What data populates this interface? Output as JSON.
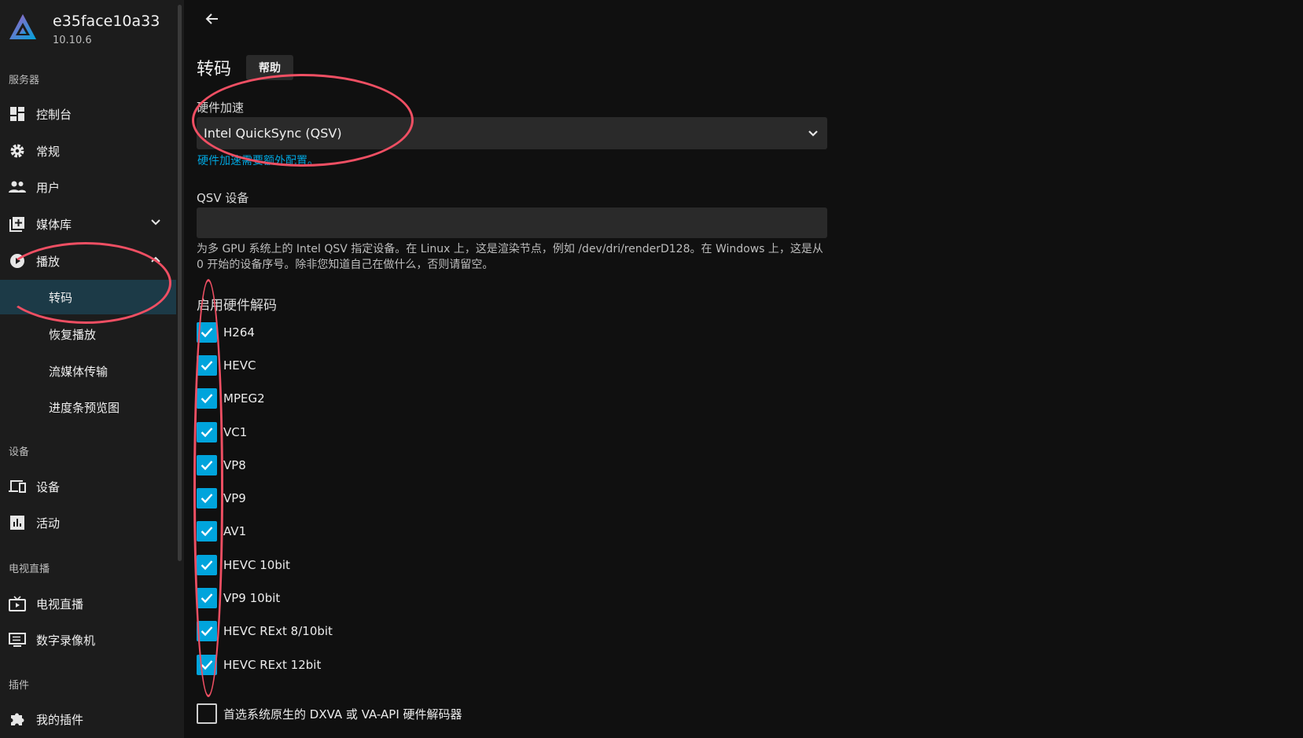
{
  "server": {
    "name": "e35face10a33",
    "version": "10.10.6"
  },
  "sidebar": {
    "sections": {
      "server": "服务器",
      "devices": "设备",
      "livetv": "电视直播",
      "plugins": "插件"
    },
    "items": {
      "dashboard": "控制台",
      "general": "常规",
      "users": "用户",
      "libraries": "媒体库",
      "playback": "播放",
      "transcoding": "转码",
      "resume": "恢复播放",
      "streaming": "流媒体传输",
      "trickplay": "进度条预览图",
      "devices": "设备",
      "activity": "活动",
      "livetv": "电视直播",
      "dvr": "数字录像机",
      "myplugins": "我的插件"
    }
  },
  "page": {
    "title": "转码",
    "help_label": "帮助",
    "hwaccel": {
      "label": "硬件加速",
      "value": "Intel QuickSync (QSV)",
      "note": "硬件加速需要额外配置。"
    },
    "qsv_device": {
      "label": "QSV 设备",
      "value": "",
      "description": "为多 GPU 系统上的 Intel QSV 指定设备。在 Linux 上，这是渲染节点，例如 /dev/dri/renderD128。在 Windows 上，这是从 0 开始的设备序号。除非您知道自己在做什么，否则请留空。"
    },
    "decode": {
      "title": "启用硬件解码",
      "codecs": {
        "h264": "H264",
        "hevc": "HEVC",
        "mpeg2": "MPEG2",
        "vc1": "VC1",
        "vp8": "VP8",
        "vp9": "VP9",
        "av1": "AV1",
        "hevc10": "HEVC 10bit",
        "vp910": "VP9 10bit",
        "hevcrext810": "HEVC RExt 8/10bit",
        "hevcrext12": "HEVC RExt 12bit"
      },
      "checked_count": 11
    },
    "prefer_native": {
      "label": "首选系统原生的 DXVA 或 VA-API 硬件解码器",
      "checked": false
    }
  },
  "colors": {
    "accent": "#00a4dc",
    "annotation": "#ef4f63",
    "active_nav": "#1c3a47"
  }
}
